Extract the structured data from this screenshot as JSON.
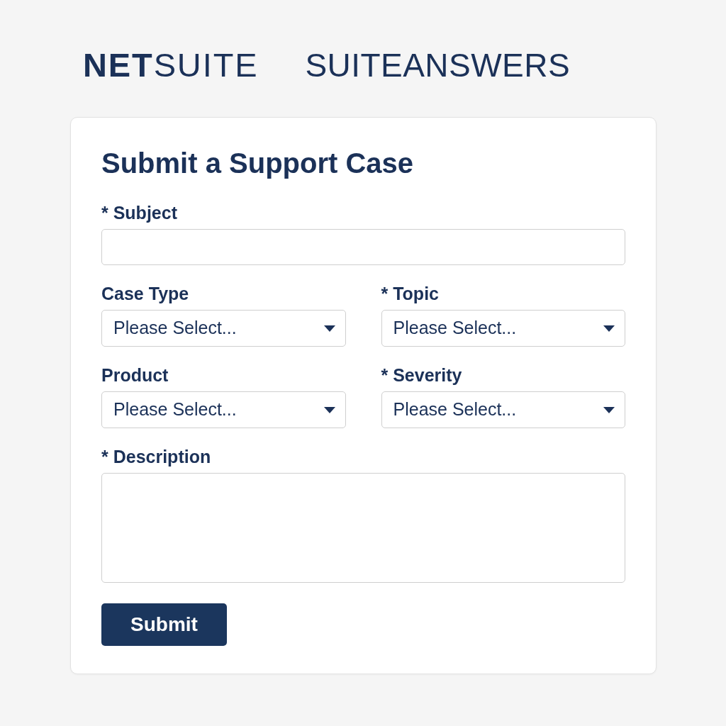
{
  "header": {
    "logo": "**NET**SUITE",
    "title": "SUITEANSWERS"
  },
  "form": {
    "title": "Submit a Support Case",
    "fields": [
      {
        "kind": "text",
        "label": "* Subject"
      },
      {
        "kind": "select",
        "label": "Case Type",
        "placeholder": "Please Select..."
      },
      {
        "kind": "select",
        "label": "* Topic",
        "placeholder": "Please Select..."
      },
      {
        "kind": "select",
        "label": "Product",
        "placeholder": "Please Select..."
      },
      {
        "kind": "select",
        "label": "* Severity",
        "placeholder": "Please Select..."
      },
      {
        "kind": "textarea",
        "label": "* Description"
      }
    ],
    "submit": "Submit"
  }
}
